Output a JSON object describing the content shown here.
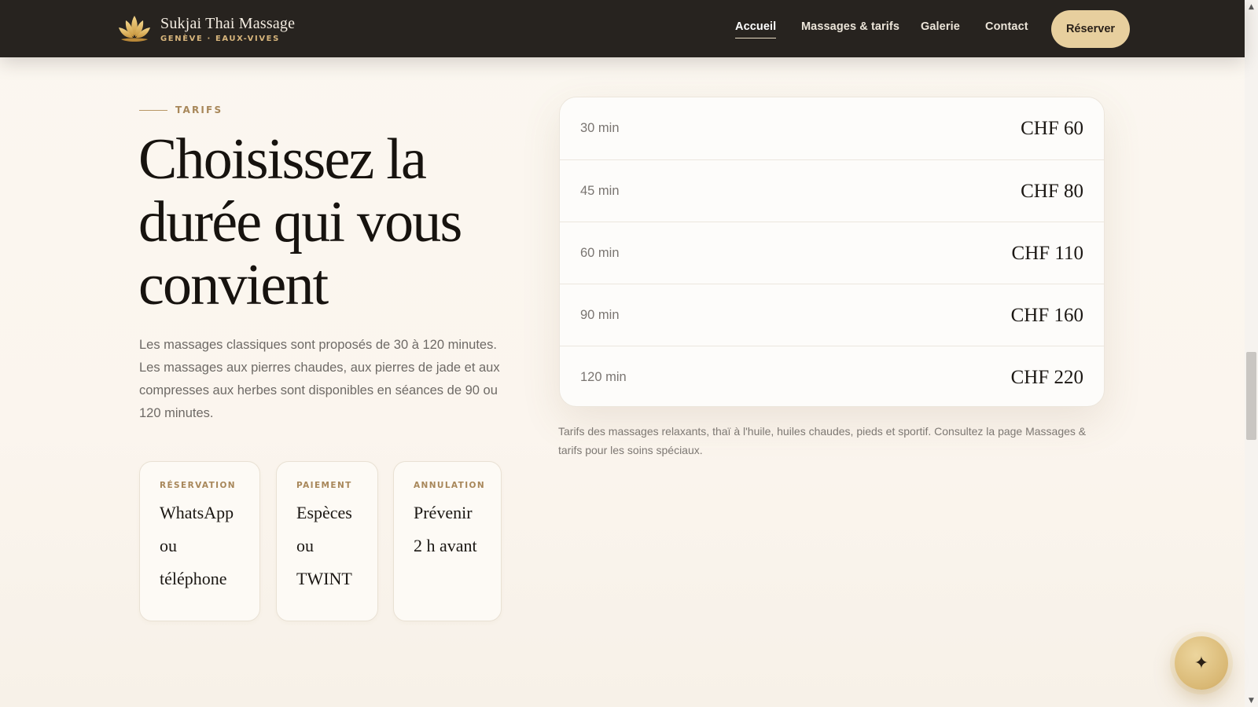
{
  "header": {
    "brand_name": "Sukjai Thai Massage",
    "brand_subtitle": "GENÈVE · EAUX-VIVES",
    "logo_icon": "lotus-icon",
    "nav": [
      {
        "label": "Accueil",
        "active": true
      },
      {
        "label": "Massages & tarifs",
        "active": false
      },
      {
        "label": "Galerie",
        "active": false
      },
      {
        "label": "Contact",
        "active": false
      }
    ],
    "cta_label": "Réserver"
  },
  "intro": {
    "eyebrow": "TARIFS",
    "title": "Choisissez la durée qui vous convient",
    "description": "Les massages classiques sont proposés de 30 à 120 minutes. Les massages aux pierres chaudes, aux pierres de jade et aux compresses aux herbes sont disponibles en séances de 90 ou 120 minutes."
  },
  "info_cards": [
    {
      "label": "RÉSERVATION",
      "value": "WhatsApp ou téléphone"
    },
    {
      "label": "PAIEMENT",
      "value": "Espèces ou TWINT"
    },
    {
      "label": "ANNULATION",
      "value": "Prévenir 2 h avant"
    }
  ],
  "prices": {
    "rows": [
      {
        "duration": "30 min",
        "price": "CHF 60"
      },
      {
        "duration": "45 min",
        "price": "CHF 80"
      },
      {
        "duration": "60 min",
        "price": "CHF 110"
      },
      {
        "duration": "90 min",
        "price": "CHF 160"
      },
      {
        "duration": "120 min",
        "price": "CHF 220"
      }
    ],
    "note": "Tarifs des massages relaxants, thaï à l'huile, huiles chaudes, pieds et sportif. Consultez la page Massages & tarifs pour les soins spéciaux."
  },
  "fab": {
    "icon": "sparkle-icon",
    "glyph": "✦"
  },
  "scrollbar": {
    "up_glyph": "▲",
    "down_glyph": "▼"
  },
  "colors": {
    "header_bg": "#27231f",
    "accent_gold": "#e7cf9e",
    "eyebrow_gold": "#a8875a",
    "page_bg": "#fbf7f0"
  }
}
